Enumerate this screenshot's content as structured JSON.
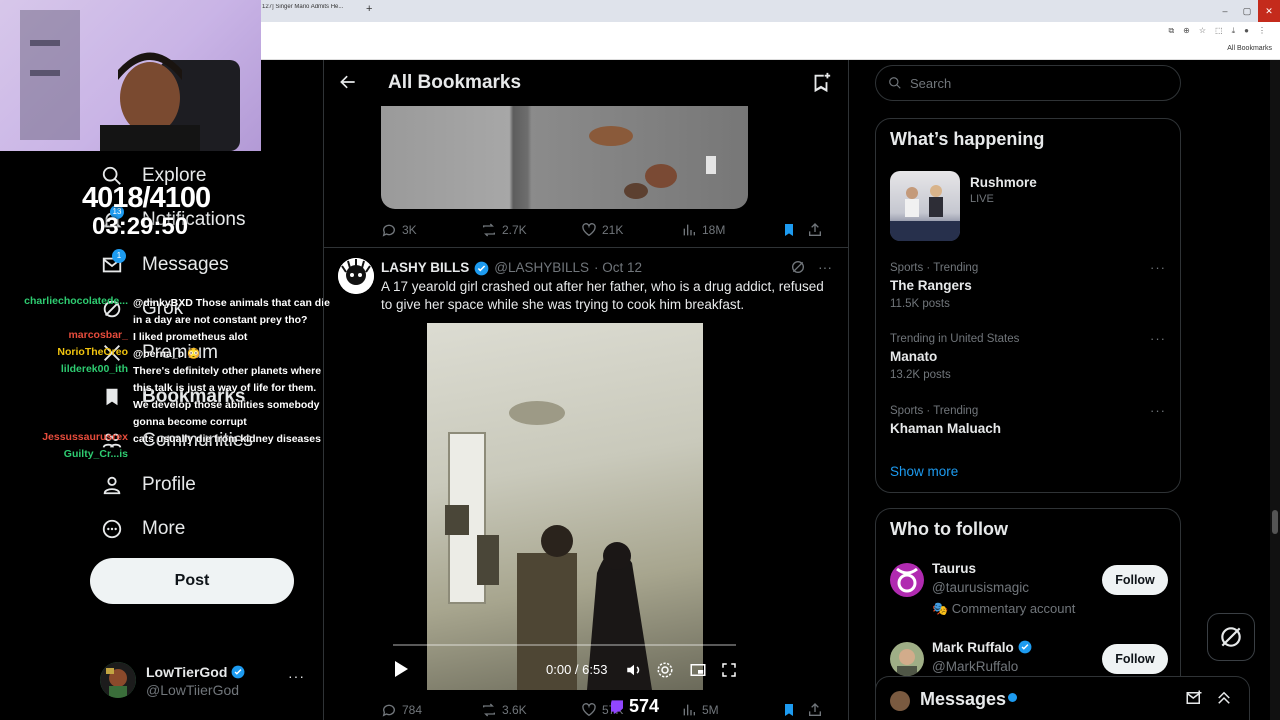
{
  "browser": {
    "tab_title": "127] Singer Mario Admits He...",
    "new_tab": "+",
    "bookmarks_folder": "All Bookmarks"
  },
  "stream": {
    "counter": "4018/4100",
    "timer": "03:29:50",
    "viewer_count": "574",
    "chat": [
      {
        "user": "",
        "message": "",
        "color": "#9b9bff"
      },
      {
        "user": "charliechocolatede...",
        "message": "@dinkyBXD Those animals that can die in a day are not constant prey tho?",
        "color": "#2ecc71"
      },
      {
        "user": "marcosbar_",
        "message": "I liked prometheus alot",
        "color": "#e74c3c"
      },
      {
        "user": "NorioTheOreo",
        "message": "@berna_b 😳",
        "color": "#f1c40f"
      },
      {
        "user": "lilderek00_ith",
        "message": "There's definitely other planets where this talk is just a way of life for them. We develop those abilities somebody gonna become corrupt",
        "color": "#2ecc71"
      },
      {
        "user": "Jessussaurusrex",
        "message": "cats usually die from kidney diseases",
        "color": "#e74c3c"
      },
      {
        "user": "Guilty_Cr...is",
        "message": "",
        "color": "#2ecc71"
      }
    ]
  },
  "nav": {
    "items": [
      {
        "label": "Explore",
        "icon": "search-icon"
      },
      {
        "label": "Notifications",
        "icon": "bell-icon",
        "badge": "13"
      },
      {
        "label": "Messages",
        "icon": "envelope-icon",
        "badge": "1"
      },
      {
        "label": "Grok",
        "icon": "grok-icon"
      },
      {
        "label": "Premium",
        "icon": "x-logo-icon"
      },
      {
        "label": "Bookmarks",
        "icon": "bookmark-icon"
      },
      {
        "label": "Communities",
        "icon": "people-icon"
      },
      {
        "label": "Profile",
        "icon": "person-icon"
      },
      {
        "label": "More",
        "icon": "more-circle-icon"
      }
    ],
    "post_label": "Post",
    "account": {
      "name": "LowTierGod",
      "handle": "@LowTiierGod",
      "more": "···"
    }
  },
  "main": {
    "title": "All Bookmarks",
    "first_tweet_stats": {
      "replies": "3K",
      "reposts": "2.7K",
      "likes": "21K",
      "views": "18M"
    },
    "tweet": {
      "name": "LASHY BILLS",
      "handle": "@LASHYBILLS",
      "date": "· Oct 12",
      "text": "A 17 yearold girl crashed out after her father, who is a drug addict, refused to give her space while she was trying to cook him breakfast.",
      "video_time": "0:00 / 6:53",
      "stats": {
        "replies": "784",
        "reposts": "3.6K",
        "likes": "57K",
        "views": "5M"
      }
    }
  },
  "sidebar": {
    "search_placeholder": "Search",
    "happening_title": "What’s happening",
    "live_item": {
      "name": "Rushmore",
      "status": "LIVE"
    },
    "trends": [
      {
        "category": "Sports · Trending",
        "name": "The Rangers",
        "count": "11.5K posts"
      },
      {
        "category": "Trending in United States",
        "name": "Manato",
        "count": "13.2K posts"
      },
      {
        "category": "Sports · Trending",
        "name": "Khaman Maluach",
        "count": ""
      }
    ],
    "show_more": "Show more",
    "who_to_follow_title": "Who to follow",
    "follow": [
      {
        "name": "Taurus",
        "handle": "@taurusismagic",
        "extra": "🎭 Commentary account",
        "button": "Follow"
      },
      {
        "name": "Mark Ruffalo",
        "handle": "@MarkRuffalo",
        "extra": "",
        "button": "Follow"
      }
    ],
    "messages_dock": "Messages"
  },
  "colors": {
    "accent": "#1d9bf0",
    "background": "#000000",
    "border": "#2f3336",
    "muted": "#71767b"
  }
}
